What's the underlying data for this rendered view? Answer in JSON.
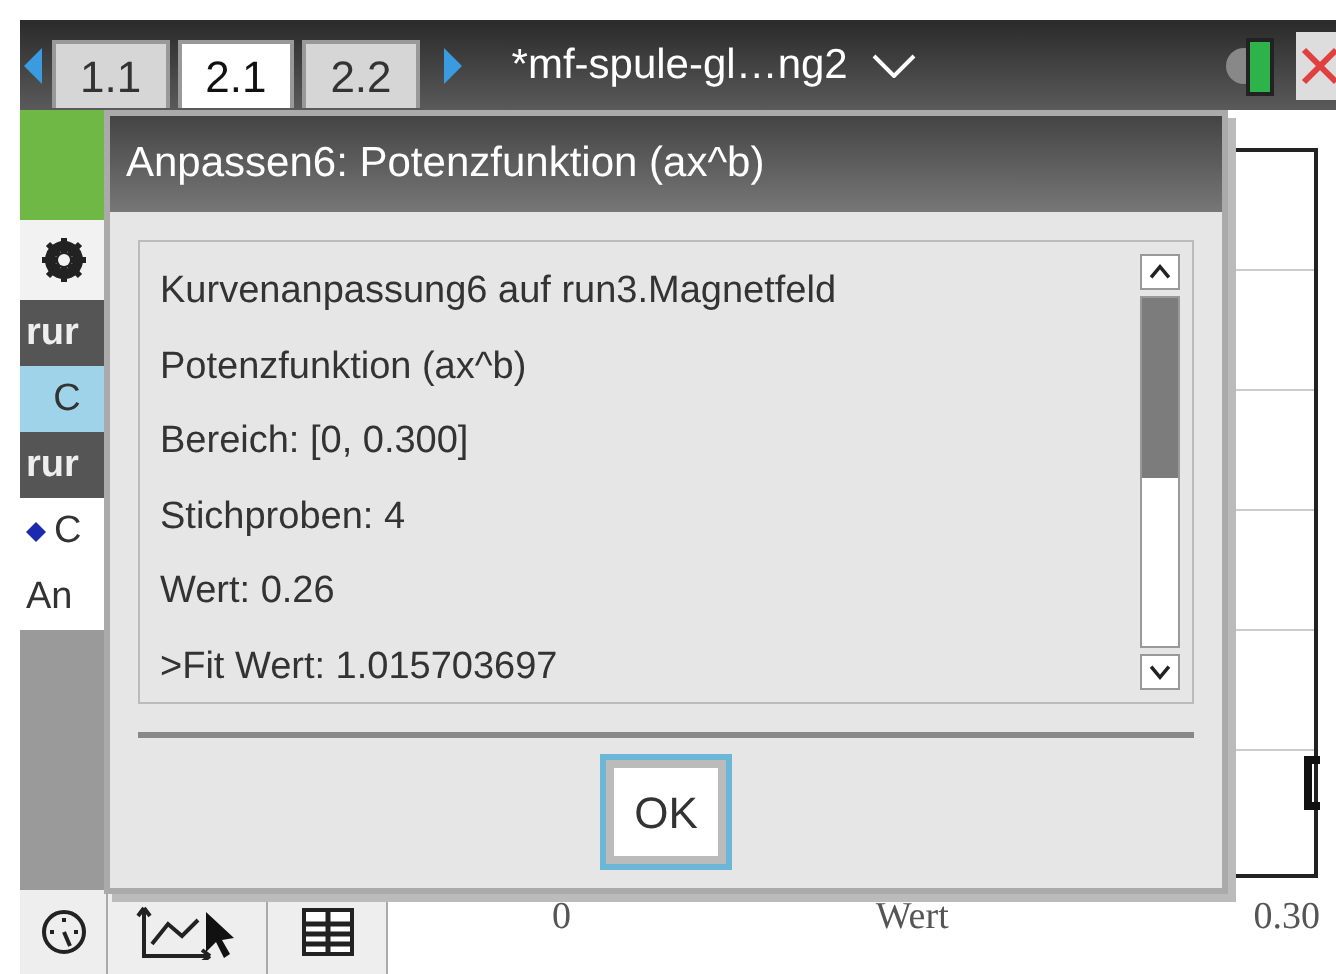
{
  "header": {
    "tabs": [
      {
        "label": "1.1",
        "selected": false
      },
      {
        "label": "2.1",
        "selected": true
      },
      {
        "label": "2.2",
        "selected": false
      }
    ],
    "document_title": "*mf-spule-gl…ng2"
  },
  "side_panel": [
    {
      "kind": "header",
      "text": "rur"
    },
    {
      "kind": "highlight",
      "text": "C"
    },
    {
      "kind": "header",
      "text": "rur"
    },
    {
      "kind": "point",
      "text": "C"
    },
    {
      "kind": "text",
      "text": "An"
    }
  ],
  "axis_labels": [
    "0",
    "Wert",
    "0.30"
  ],
  "dialog": {
    "title": "Anpassen6: Potenzfunktion (ax^b)",
    "lines": [
      "Kurvenanpassung6 auf run3.Magnetfeld",
      "Potenzfunktion (ax^b)",
      "Bereich: [0, 0.300]",
      "Stichproben: 4",
      "Wert: 0.26",
      ">Fit Wert: 1.015703697"
    ],
    "button": "OK"
  }
}
